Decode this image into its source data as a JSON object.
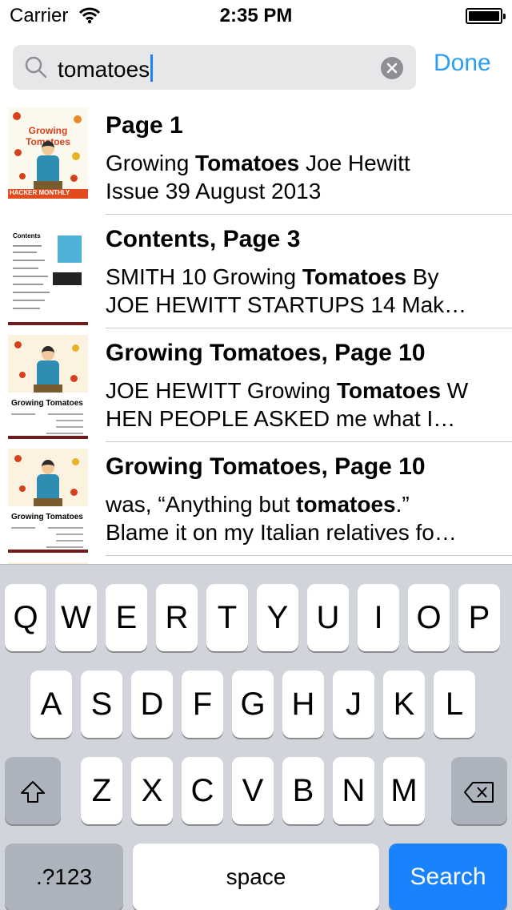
{
  "status_bar": {
    "carrier": "Carrier",
    "time": "2:35 PM"
  },
  "search": {
    "value": "tomatoes",
    "cancel_label": "Done"
  },
  "results": [
    {
      "title": "Page 1",
      "snippet_1": [
        {
          "text": "Growing "
        },
        {
          "text": "Tomatoes",
          "bold": true
        },
        {
          "text": " Joe Hewitt"
        }
      ],
      "snippet_2": [
        {
          "text": "Issue 39 August 2013"
        }
      ],
      "thumbnail": "cover"
    },
    {
      "title": "Contents, Page 3",
      "snippet_1": [
        {
          "text": "SMITH 10 Growing "
        },
        {
          "text": "Tomatoes",
          "bold": true
        },
        {
          "text": " By"
        }
      ],
      "snippet_2": [
        {
          "text": "JOE HEWITT STARTUPS 14 Mak…"
        }
      ],
      "thumbnail": "contents"
    },
    {
      "title": "Growing Tomatoes, Page 10",
      "snippet_1": [
        {
          "text": "JOE HEWITT Growing "
        },
        {
          "text": "Tomatoes",
          "bold": true
        },
        {
          "text": " W"
        }
      ],
      "snippet_2": [
        {
          "text": "HEN PEOPLE ASKED me what I…"
        }
      ],
      "thumbnail": "page10"
    },
    {
      "title": "Growing Tomatoes, Page 10",
      "snippet_1": [
        {
          "text": "was, “Anything but "
        },
        {
          "text": "tomatoes",
          "bold": true
        },
        {
          "text": ".”"
        }
      ],
      "snippet_2": [
        {
          "text": "Blame it on my Italian relatives fo…"
        }
      ],
      "thumbnail": "page10"
    }
  ],
  "thumbnail_text": {
    "cover_title": "Growing Tomatoes",
    "cover_banner": "HACKER MONTHLY",
    "contents_heading": "Contents",
    "page10_heading": "Growing Tomatoes"
  },
  "keyboard": {
    "row1": [
      "Q",
      "W",
      "E",
      "R",
      "T",
      "Y",
      "U",
      "I",
      "O",
      "P"
    ],
    "row2": [
      "A",
      "S",
      "D",
      "F",
      "G",
      "H",
      "J",
      "K",
      "L"
    ],
    "row3": [
      "Z",
      "X",
      "C",
      "V",
      "B",
      "N",
      "M"
    ],
    "numbers_label": ".?123",
    "space_label": "space",
    "search_label": "Search"
  },
  "colors": {
    "accent": "#2a9ef0",
    "search_key": "#1a82fb",
    "keyboard_bg": "#d1d5db"
  }
}
